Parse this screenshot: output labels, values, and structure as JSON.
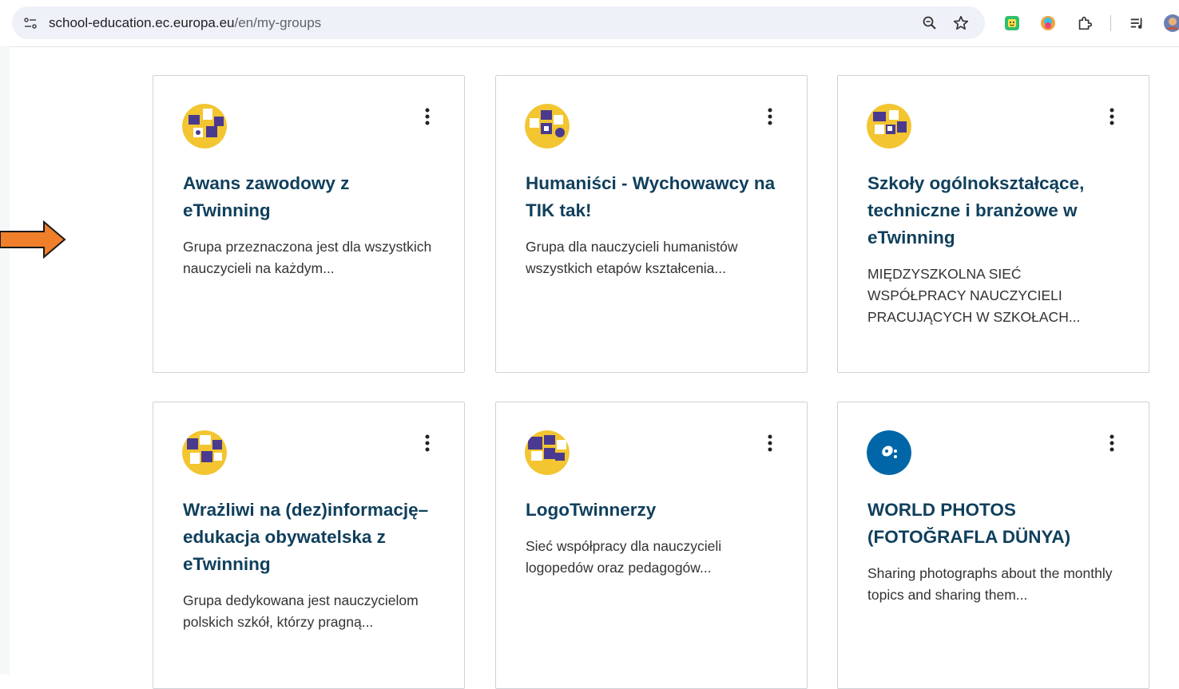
{
  "browser": {
    "url_host": "school-education.ec.europa.eu",
    "url_path": "/en/my-groups",
    "icons": [
      "site-info-icon",
      "zoom-icon",
      "bookmark-star-icon",
      "extension-green-icon",
      "extension-avatar-icon",
      "extensions-puzzle-icon",
      "media-control-icon",
      "profile-avatar-icon"
    ]
  },
  "groups": [
    {
      "title": "Awans zawodowy z eTwinning",
      "description": "Grupa przeznaczona jest dla wszystkich nauczycieli na każdym..."
    },
    {
      "title": "Humaniści - Wychowawcy na TIK tak!",
      "description": "Grupa dla nauczycieli humanistów wszystkich etapów kształcenia..."
    },
    {
      "title": "Szkoły ogólnokształcące, techniczne i branżowe w eTwinning",
      "description": "MIĘDZYSZKOLNA SIEĆ WSPÓŁPRACY NAUCZYCIELI PRACUJĄCYCH W SZKOŁACH..."
    },
    {
      "title": "Wrażliwi na (dez)informację– edukacja obywatelska z eTwinning",
      "description": "Grupa dedykowana jest nauczycielom polskich szkół, którzy pragną..."
    },
    {
      "title": "LogoTwinnerzy",
      "description": "Sieć współpracy dla nauczycieli logopedów oraz pedagogów..."
    },
    {
      "title": "WORLD PHOTOS (FOTOĞRAFLA DÜNYA)",
      "description": "Sharing photographs about the monthly topics and sharing them..."
    }
  ],
  "colors": {
    "title": "#0f3f5c",
    "arrow": "#ef7f2a",
    "avatar_yellow": "#f2c531",
    "avatar_purple": "#4a3a8f",
    "avatar_blue": "#0066a8"
  }
}
